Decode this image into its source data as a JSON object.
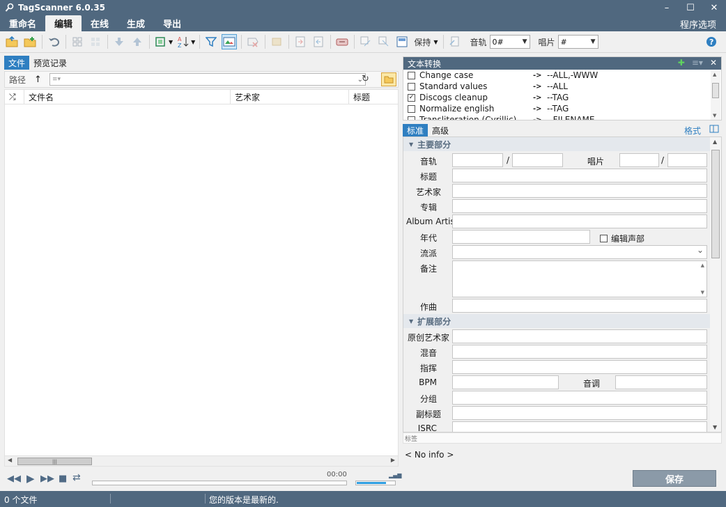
{
  "window": {
    "title": "TagScanner 6.0.35"
  },
  "menu": {
    "items": [
      "重命名",
      "编辑",
      "在线",
      "生成",
      "导出"
    ],
    "active_index": 1,
    "options": "程序选项"
  },
  "toolbar": {
    "save_mode_label": "保持",
    "track_label": "音轨",
    "track_value": "0#",
    "disc_label": "唱片",
    "disc_value": "#"
  },
  "left": {
    "tabs": [
      "文件",
      "预览记录"
    ],
    "path_label": "路径",
    "path_placeholder": "≡▾",
    "columns": [
      "文件名",
      "艺术家",
      "标题"
    ]
  },
  "player": {
    "time": "00:00",
    "volume_level": 0.78
  },
  "conversion": {
    "title": "文本转换",
    "rows": [
      {
        "name": "Change case",
        "checked": false,
        "target": "--ALL,-WWW"
      },
      {
        "name": "Standard values",
        "checked": false,
        "target": "--ALL"
      },
      {
        "name": "Discogs cleanup",
        "checked": true,
        "target": "--TAG"
      },
      {
        "name": "Normalize english",
        "checked": false,
        "target": "--TAG"
      },
      {
        "name": "Transliteration (Cyrillic)",
        "checked": false,
        "target": "--FILENAME"
      }
    ]
  },
  "tag_editor": {
    "tabs": [
      "标准",
      "高级"
    ],
    "format_label": "格式",
    "main_section": "主要部分",
    "ext_section": "扩展部分",
    "labels": {
      "track": "音轨",
      "disc": "唱片",
      "title": "标题",
      "artist": "艺术家",
      "album": "专辑",
      "album_artist": "Album Artist",
      "year": "年代",
      "edit_voice": "编辑声部",
      "genre": "流派",
      "comment": "备注",
      "composer": "作曲",
      "orig_artist": "原创艺术家",
      "remix": "混音",
      "conductor": "指挥",
      "bpm": "BPM",
      "key": "音调",
      "grouping": "分组",
      "subtitle": "副标题",
      "isrc": "ISRC"
    },
    "bottom_strip": "标签",
    "info": "< No info >",
    "save": "保存"
  },
  "status": {
    "file_count": "0 个文件",
    "message": "您的版本是最新的."
  },
  "colors": {
    "chrome": "#50687f",
    "accent": "#2f7fc1"
  }
}
